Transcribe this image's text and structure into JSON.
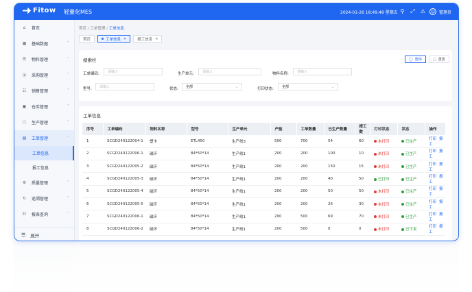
{
  "header": {
    "logo": "Fitow",
    "app_name": "轻量化MES",
    "datetime": "2024-01-26 18:49:48 星期五",
    "user": "管理员",
    "colors": {
      "primary": "#1f66f0"
    }
  },
  "sidebar": {
    "items": [
      {
        "label": "首页",
        "icon": "home-icon"
      },
      {
        "label": "基础数据",
        "icon": "grid-icon"
      },
      {
        "label": "物料管理",
        "icon": "list-icon"
      },
      {
        "label": "采购管理",
        "icon": "cart-icon"
      },
      {
        "label": "销售管理",
        "icon": "sales-icon"
      },
      {
        "label": "仓库管理",
        "icon": "warehouse-icon"
      },
      {
        "label": "生产管理",
        "icon": "factory-icon"
      },
      {
        "label": "工单管理",
        "icon": "order-icon"
      }
    ],
    "sub_items": [
      {
        "label": "工单信息"
      },
      {
        "label": "报工信息"
      }
    ],
    "items_after": [
      {
        "label": "质量管理",
        "icon": "quality-icon"
      },
      {
        "label": "追溯管理",
        "icon": "trace-icon"
      },
      {
        "label": "报表查询",
        "icon": "report-icon"
      }
    ],
    "expand_label": "展开"
  },
  "breadcrumb": {
    "items": [
      "首页",
      "工单管理",
      "工单信息"
    ]
  },
  "tabs": [
    {
      "label": "首页"
    },
    {
      "label": "工单信息"
    },
    {
      "label": "报工信息"
    }
  ],
  "search": {
    "title": "搜索栏",
    "query_label": "查询",
    "reset_label": "重置",
    "fields": {
      "order_code": {
        "label": "工单编码:",
        "placeholder": "请输入"
      },
      "production_unit": {
        "label": "生产单元:",
        "placeholder": "请输入"
      },
      "material_name": {
        "label": "物料名称:",
        "placeholder": "请输入"
      },
      "model": {
        "label": "型号:",
        "placeholder": "请输入"
      },
      "status": {
        "label": "状态:",
        "value": "全部"
      },
      "print_status": {
        "label": "打印状态:",
        "value": "全部"
      }
    }
  },
  "list": {
    "title": "工单信息",
    "columns": [
      "序号",
      "工单编码",
      "物料名称",
      "型号",
      "生产单元",
      "产能",
      "工单数量",
      "已生产数量",
      "报工数",
      "打印状态",
      "状态",
      "操作"
    ],
    "print_label": "打印",
    "report_label": "报工",
    "rows": [
      {
        "no": "1",
        "code": "SCGD240122004-1",
        "material": "塑卡",
        "model": "ETL450",
        "unit": "生产线3",
        "capacity": "500",
        "qty": "700",
        "produced": "54",
        "reported": "60",
        "print": "未打印",
        "status": "已生产"
      },
      {
        "no": "2",
        "code": "SCGD240122006-1",
        "material": "磁环",
        "model": "84*50*14",
        "unit": "生产线1",
        "capacity": "200",
        "qty": "200",
        "produced": "100",
        "reported": "10",
        "print": "未打印",
        "status": "已生产"
      },
      {
        "no": "3",
        "code": "SCGD240122005-2",
        "material": "磁环",
        "model": "84*50*14",
        "unit": "生产线1",
        "capacity": "200",
        "qty": "200",
        "produced": "150",
        "reported": "15",
        "print": "未打印",
        "status": "已生产"
      },
      {
        "no": "4",
        "code": "SCGD240122005-3",
        "material": "磁环",
        "model": "84*50*14",
        "unit": "生产线1",
        "capacity": "200",
        "qty": "200",
        "produced": "40",
        "reported": "50",
        "print": "已打印",
        "status": "已生产"
      },
      {
        "no": "5",
        "code": "SCGD240122005-4",
        "material": "磁环",
        "model": "84*50*14",
        "unit": "生产线1",
        "capacity": "200",
        "qty": "200",
        "produced": "50",
        "reported": "50",
        "print": "未打印",
        "status": "已生产"
      },
      {
        "no": "6",
        "code": "SCGD240122005-5",
        "material": "磁环",
        "model": "84*50*14",
        "unit": "生产线1",
        "capacity": "200",
        "qty": "200",
        "produced": "26",
        "reported": "30",
        "print": "未打印",
        "status": "已生产"
      },
      {
        "no": "7",
        "code": "SCGD240122006-1",
        "material": "磁环",
        "model": "84*50*14",
        "unit": "生产线1",
        "capacity": "200",
        "qty": "500",
        "produced": "69",
        "reported": "70",
        "print": "未打印",
        "status": "已生产"
      },
      {
        "no": "8",
        "code": "SCGD240122006-2",
        "material": "磁环",
        "model": "84*50*14",
        "unit": "生产线1",
        "capacity": "200",
        "qty": "500",
        "produced": "0",
        "reported": "0",
        "print": "未打印",
        "status": "已下发"
      }
    ]
  }
}
